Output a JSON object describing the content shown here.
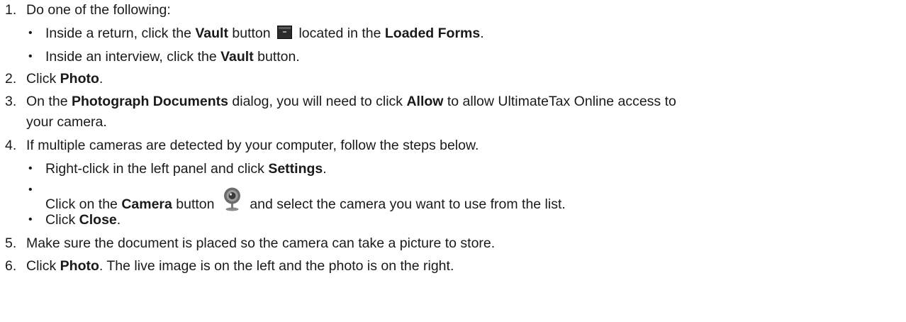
{
  "steps": [
    {
      "num": "1.",
      "text": "Do one of the following:"
    },
    {
      "num": "2.",
      "pre": "Click ",
      "bold": "Photo",
      "post": "."
    },
    {
      "num": "3.",
      "pre": "On the ",
      "bold1": "Photograph Documents",
      "mid": " dialog, you will need to click ",
      "bold2": "Allow",
      "post": " to allow UltimateTax Online access to",
      "cont": "your camera."
    },
    {
      "num": "4.",
      "text": "If multiple cameras are detected by your computer, follow the steps below."
    },
    {
      "num": "5.",
      "text": "Make sure the document is placed so the camera can take a picture to store."
    },
    {
      "num": "6.",
      "pre": "Click ",
      "bold": "Photo",
      "post": ". The live image is on the left and the photo is on the right."
    }
  ],
  "step1_bullets": [
    {
      "pre": "Inside a return, click the ",
      "bold1": "Vault",
      "mid1": " button ",
      "icon": "vault-icon",
      "mid2": " located in the ",
      "bold2": "Loaded Forms",
      "post": "."
    },
    {
      "pre": "Inside an interview, click the ",
      "bold": "Vault",
      "post": " button."
    }
  ],
  "step4_bullets": [
    {
      "pre": "Right-click in the left panel and click ",
      "bold": "Settings",
      "post": "."
    },
    {
      "pre": "Click on the ",
      "bold": "Camera",
      "mid": " button ",
      "icon": "camera-icon",
      "post": " and select the camera you want to use from the list."
    },
    {
      "pre": "Click ",
      "bold": "Close",
      "post": "."
    }
  ],
  "bullet_char": "•",
  "colors": {
    "text": "#1a1a1a",
    "vault_icon": "#2b2b2b",
    "camera_icon": "#6b6b6b"
  }
}
